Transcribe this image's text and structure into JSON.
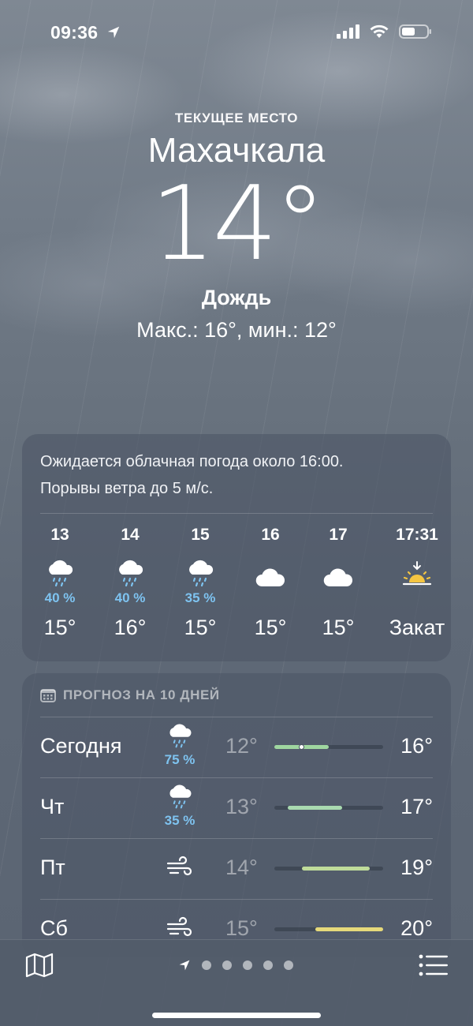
{
  "status_bar": {
    "time": "09:36",
    "icons": [
      "location-arrow-icon",
      "cellular-signal-icon",
      "wifi-icon",
      "battery-icon"
    ]
  },
  "header": {
    "current_label": "ТЕКУЩЕЕ МЕСТО",
    "city": "Махачкала",
    "temperature": "14°",
    "condition": "Дождь",
    "min_max": "Макс.: 16°, мин.: 12°"
  },
  "hourly": {
    "summary_line1": "Ожидается облачная погода около 16:00.",
    "summary_line2": "Порывы ветра до 5 м/с.",
    "items": [
      {
        "time": "13",
        "icon": "cloud-rain-icon",
        "prob": "40 %",
        "temp": "15°"
      },
      {
        "time": "14",
        "icon": "cloud-rain-icon",
        "prob": "40 %",
        "temp": "16°"
      },
      {
        "time": "15",
        "icon": "cloud-rain-icon",
        "prob": "35 %",
        "temp": "15°"
      },
      {
        "time": "16",
        "icon": "cloud-icon",
        "prob": "",
        "temp": "15°"
      },
      {
        "time": "17",
        "icon": "cloud-icon",
        "prob": "",
        "temp": "15°"
      },
      {
        "time": "17:31",
        "icon": "sunset-icon",
        "prob": "",
        "temp": "Закат"
      }
    ]
  },
  "daily": {
    "header": "ПРОГНОЗ НА 10 ДНЕЙ",
    "header_icon": "calendar-icon",
    "range_min": 12,
    "range_max": 20,
    "rows": [
      {
        "day": "Сегодня",
        "icon": "cloud-rain-icon",
        "prob": "75 %",
        "min": "12°",
        "max": "16°",
        "min_val": 12,
        "max_val": 16,
        "current": 14,
        "bar_color": "#9fd6a0"
      },
      {
        "day": "Чт",
        "icon": "cloud-rain-icon",
        "prob": "35 %",
        "min": "13°",
        "max": "17°",
        "min_val": 13,
        "max_val": 17,
        "bar_color": "#a9dab0"
      },
      {
        "day": "Пт",
        "icon": "wind-icon",
        "prob": "",
        "min": "14°",
        "max": "19°",
        "min_val": 14,
        "max_val": 19,
        "bar_color": "#bfdc9a"
      },
      {
        "day": "Сб",
        "icon": "wind-icon",
        "prob": "",
        "min": "15°",
        "max": "20°",
        "min_val": 15,
        "max_val": 20,
        "bar_color": "#e6d97a"
      }
    ]
  },
  "bottom_bar": {
    "map_icon": "map-icon",
    "location_icon": "location-arrow-icon",
    "page_count": 5,
    "list_icon": "list-icon"
  },
  "colors": {
    "precip": "#7ec3f0",
    "sun": "#f4c542"
  }
}
